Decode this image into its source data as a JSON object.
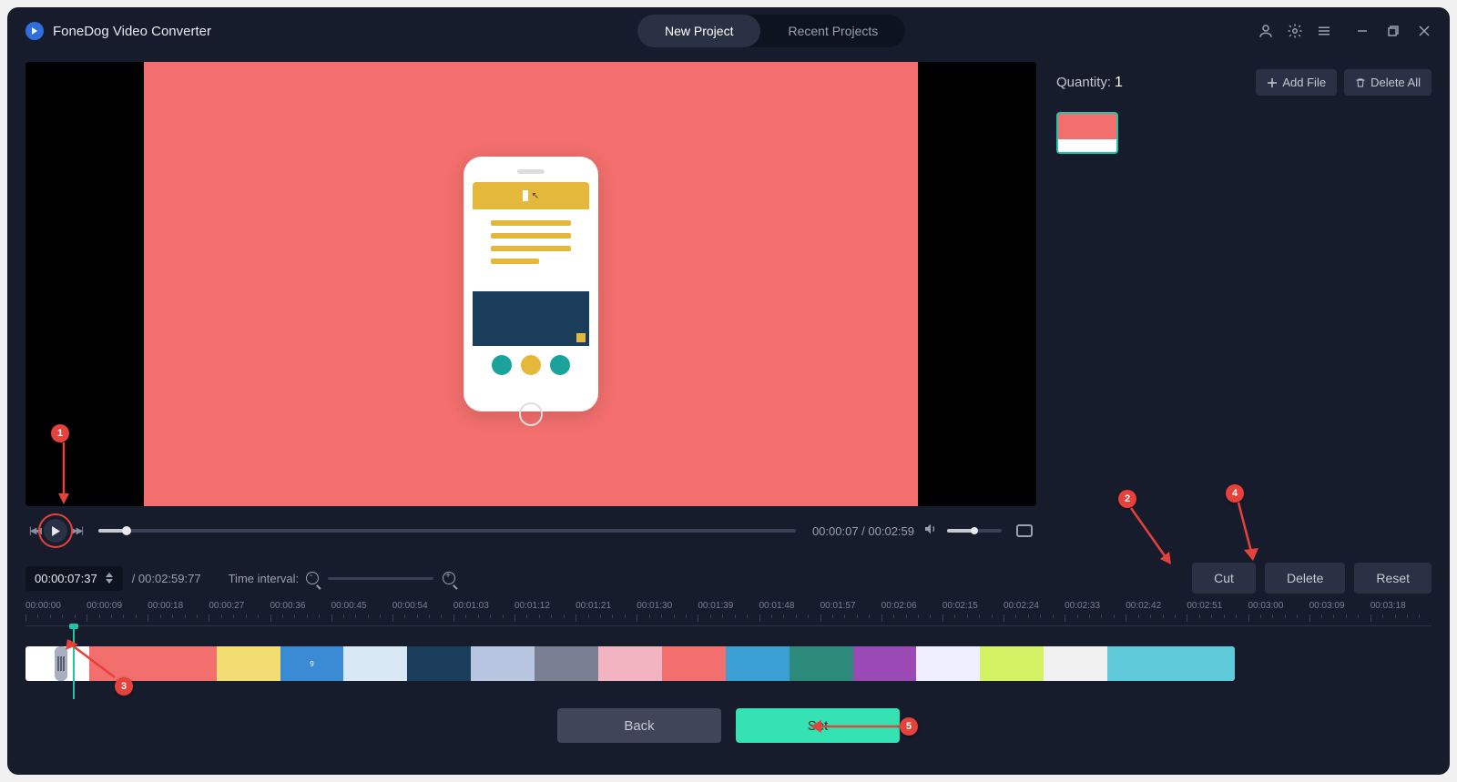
{
  "app": {
    "title": "FoneDog Video Converter"
  },
  "tabs": {
    "new_project": "New Project",
    "recent_projects": "Recent Projects"
  },
  "player": {
    "time_display": "00:00:07 / 00:02:59"
  },
  "right": {
    "quantity_label": "Quantity:",
    "quantity_value": "1",
    "add_file": "Add File",
    "delete_all": "Delete All"
  },
  "toolbar": {
    "time_in": "00:00:07:37",
    "time_total": "/ 00:02:59:77",
    "interval_label": "Time interval:",
    "cut": "Cut",
    "delete": "Delete",
    "reset": "Reset"
  },
  "ruler": [
    "00:00:00",
    "00:00:09",
    "00:00:18",
    "00:00:27",
    "00:00:36",
    "00:00:45",
    "00:00:54",
    "00:01:03",
    "00:01:12",
    "00:01:21",
    "00:01:30",
    "00:01:39",
    "00:01:48",
    "00:01:57",
    "00:02:06",
    "00:02:15",
    "00:02:24",
    "00:02:33",
    "00:02:42",
    "00:02:51",
    "00:03:00",
    "00:03:09",
    "00:03:18"
  ],
  "bottom": {
    "back": "Back",
    "set": "Set"
  },
  "annotations": {
    "a1": "1",
    "a2": "2",
    "a3": "3",
    "a4": "4",
    "a5": "5"
  }
}
